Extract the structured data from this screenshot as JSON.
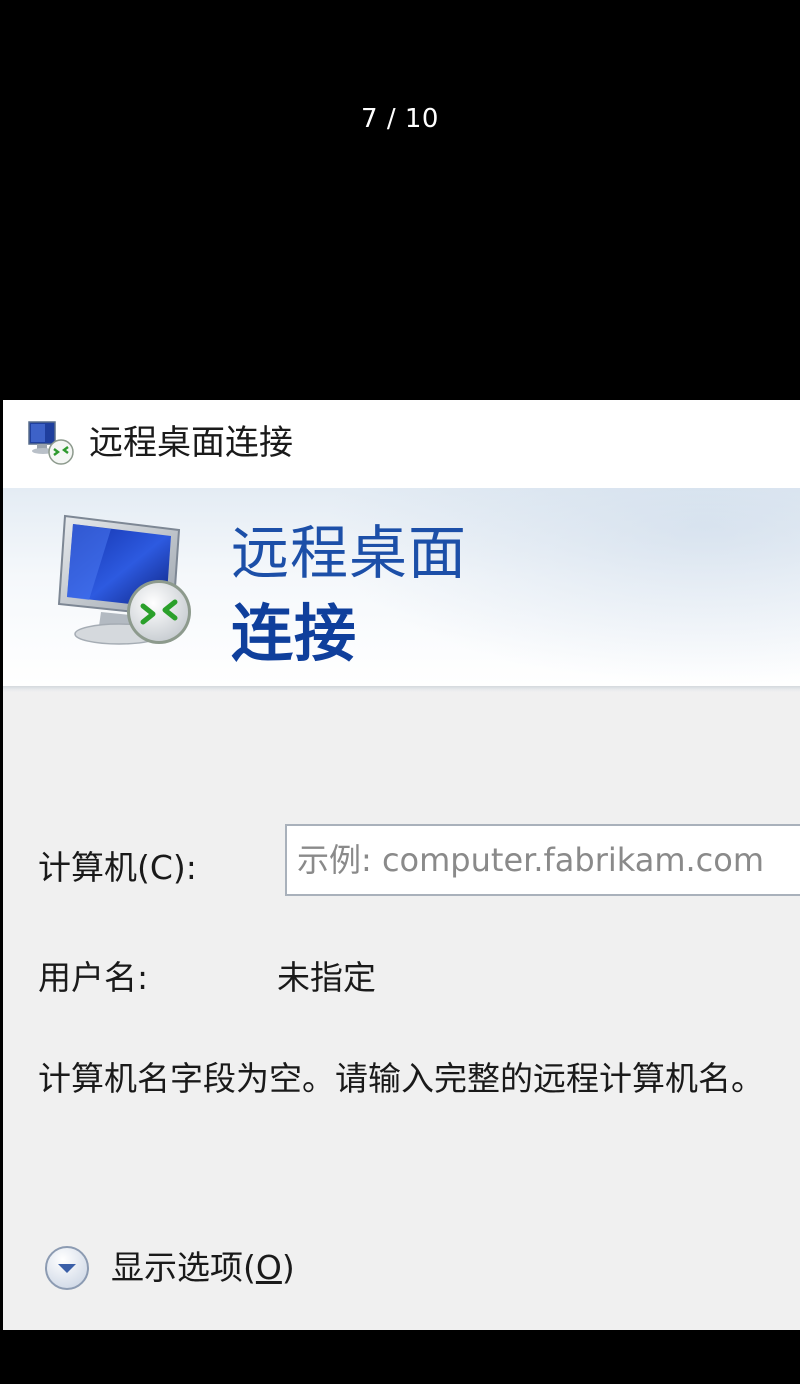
{
  "viewer": {
    "page_counter": "7 / 10"
  },
  "dialog": {
    "title": "远程桌面连接",
    "banner": {
      "line1": "远程桌面",
      "line2": "连接"
    },
    "computer": {
      "label": "计算机(C):",
      "value": "",
      "placeholder": "示例: computer.fabrikam.com"
    },
    "username": {
      "label": "用户名:",
      "value": "未指定"
    },
    "message": "计算机名字段为空。请输入完整的远程计算机名。",
    "show_options": {
      "label_prefix": "显示选项(",
      "mnemonic": "O",
      "label_suffix": ")"
    },
    "icons": {
      "app": "remote-desktop-icon",
      "banner": "remote-desktop-monitor-icon",
      "toggle": "chevron-down-circle-icon"
    },
    "colors": {
      "banner_title": "#1c4fa8",
      "banner_title_bold": "#0f3f9c",
      "dialog_bg": "#f0f0f0",
      "viewer_bg": "#000000"
    }
  }
}
